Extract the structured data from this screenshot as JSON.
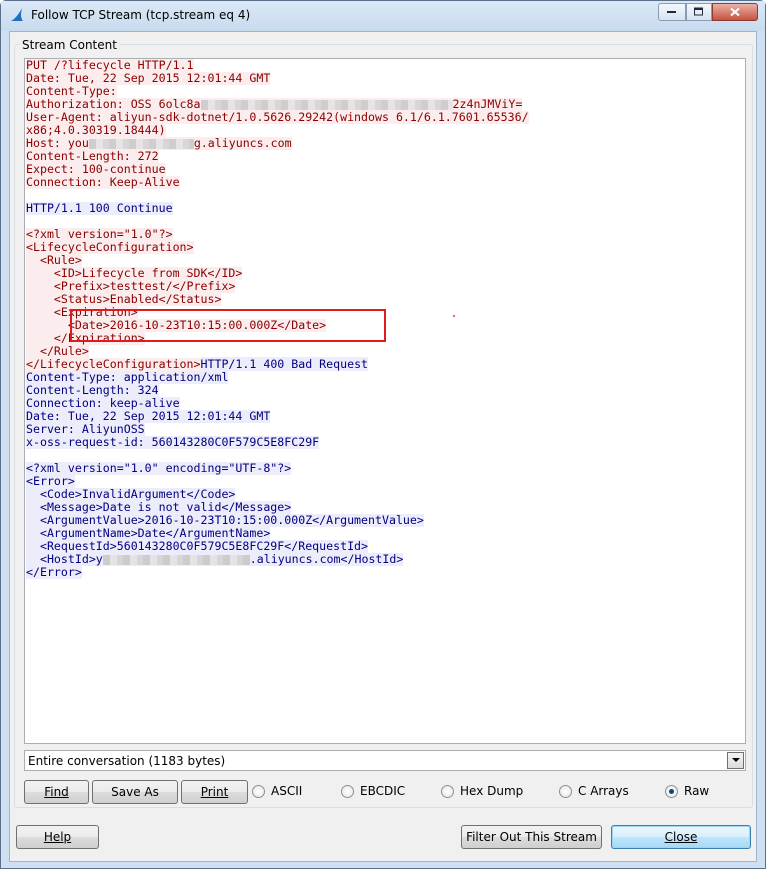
{
  "window": {
    "title": "Follow TCP Stream (tcp.stream eq 4)"
  },
  "group": {
    "label": "Stream Content"
  },
  "stream": {
    "lines": [
      {
        "who": "client",
        "text": "PUT /?lifecycle HTTP/1.1"
      },
      {
        "who": "client",
        "text": "Date: Tue, 22 Sep 2015 12:01:44 GMT"
      },
      {
        "who": "client",
        "text": "Content-Type:"
      },
      {
        "who": "client",
        "text": "Authorization: OSS 6olc8a",
        "redact": 36,
        "after": "2z4nJMViY="
      },
      {
        "who": "client",
        "text": "User-Agent: aliyun-sdk-dotnet/1.0.5626.29242(windows 6.1/6.1.7601.65536/"
      },
      {
        "who": "client",
        "text": "x86;4.0.30319.18444)"
      },
      {
        "who": "client",
        "text": "Host: you",
        "redact": 15,
        "after": "g.aliyuncs.com"
      },
      {
        "who": "client",
        "text": "Content-Length: 272"
      },
      {
        "who": "client",
        "text": "Expect: 100-continue"
      },
      {
        "who": "client",
        "text": "Connection: Keep-Alive"
      },
      {
        "who": "blank",
        "text": ""
      },
      {
        "who": "server",
        "text": "HTTP/1.1 100 Continue"
      },
      {
        "who": "blank",
        "text": ""
      },
      {
        "who": "client",
        "text": "<?xml version=\"1.0\"?>"
      },
      {
        "who": "client",
        "text": "<LifecycleConfiguration>"
      },
      {
        "who": "client",
        "text": "  <Rule>"
      },
      {
        "who": "client",
        "text": "    <ID>Lifecycle from SDK</ID>"
      },
      {
        "who": "client",
        "text": "    <Prefix>testtest/</Prefix>"
      },
      {
        "who": "client",
        "text": "    <Status>Enabled</Status>"
      },
      {
        "who": "client",
        "text": "    <Expiration>"
      },
      {
        "who": "client",
        "text": "      <Date>2016-10-23T10:15:00.000Z</Date>"
      },
      {
        "who": "client",
        "text": "    </Expiration>"
      },
      {
        "who": "client",
        "text": "  </Rule>"
      },
      {
        "who": "client",
        "text": "</LifecycleConfiguration>",
        "server_after": "HTTP/1.1 400 Bad Request"
      },
      {
        "who": "server",
        "text": "Content-Type: application/xml"
      },
      {
        "who": "server",
        "text": "Content-Length: 324"
      },
      {
        "who": "server",
        "text": "Connection: keep-alive"
      },
      {
        "who": "server",
        "text": "Date: Tue, 22 Sep 2015 12:01:44 GMT"
      },
      {
        "who": "server",
        "text": "Server: AliyunOSS"
      },
      {
        "who": "server",
        "text": "x-oss-request-id: 560143280C0F579C5E8FC29F"
      },
      {
        "who": "blank",
        "text": ""
      },
      {
        "who": "server",
        "text": "<?xml version=\"1.0\" encoding=\"UTF-8\"?>"
      },
      {
        "who": "server",
        "text": "<Error>"
      },
      {
        "who": "server",
        "text": "  <Code>InvalidArgument</Code>"
      },
      {
        "who": "server",
        "text": "  <Message>Date is not valid</Message>"
      },
      {
        "who": "server",
        "text": "  <ArgumentValue>2016-10-23T10:15:00.000Z</ArgumentValue>"
      },
      {
        "who": "server",
        "text": "  <ArgumentName>Date</ArgumentName>"
      },
      {
        "who": "server",
        "text": "  <RequestId>560143280C0F579C5E8FC29F</RequestId>"
      },
      {
        "who": "server",
        "text": "  <HostId>y",
        "redact": 21,
        "after": ".aliyuncs.com</HostId>"
      },
      {
        "who": "server",
        "text": "</Error>"
      }
    ]
  },
  "conversation_select": {
    "value": "Entire conversation (1183 bytes)"
  },
  "buttons": {
    "find": "Find",
    "save_as": "Save As",
    "print": "Print",
    "help": "Help",
    "filter_out": "Filter Out This Stream",
    "close": "Close"
  },
  "formats": [
    {
      "label": "ASCII",
      "selected": false
    },
    {
      "label": "EBCDIC",
      "selected": false
    },
    {
      "label": "Hex Dump",
      "selected": false
    },
    {
      "label": "C Arrays",
      "selected": false
    },
    {
      "label": "Raw",
      "selected": true
    }
  ],
  "colors": {
    "client_text": "#8b0000",
    "client_bg": "#fbeded",
    "server_text": "#000080",
    "server_bg": "#ececfb",
    "annotation": "#e01b1b"
  }
}
